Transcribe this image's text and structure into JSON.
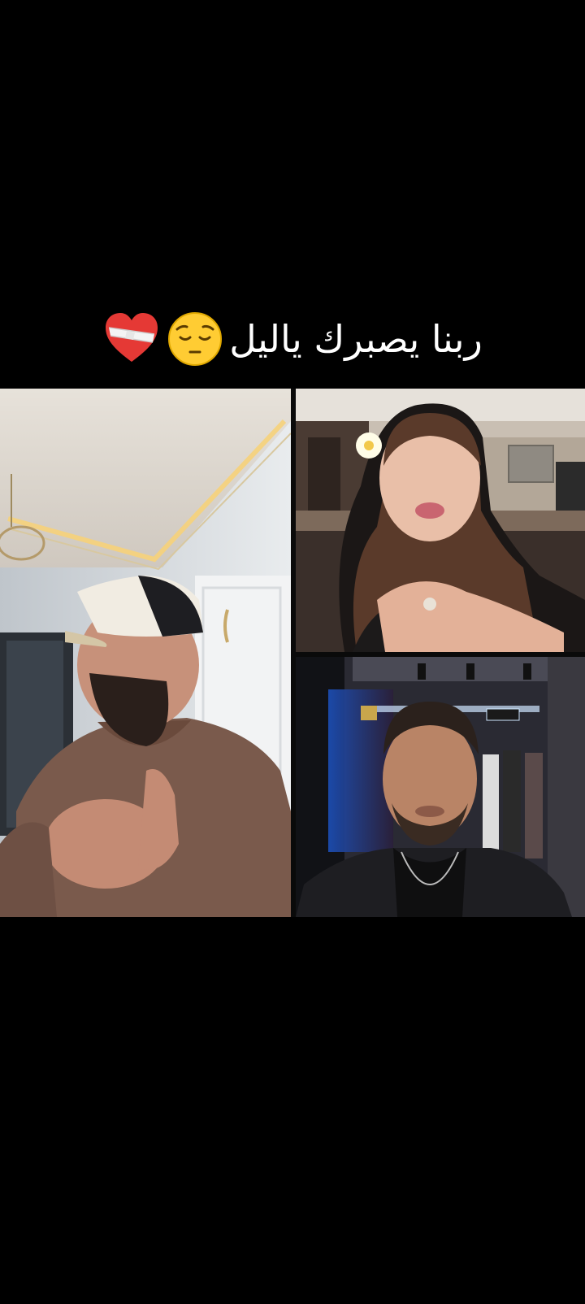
{
  "caption": {
    "text": "ربنا يصبرك ياليل"
  },
  "icons": {
    "emoji_sad": "pensive-face-icon",
    "emoji_heart": "mending-heart-icon"
  },
  "participants": [
    {
      "tile": "left"
    },
    {
      "tile": "top-right"
    },
    {
      "tile": "bottom-right"
    }
  ]
}
